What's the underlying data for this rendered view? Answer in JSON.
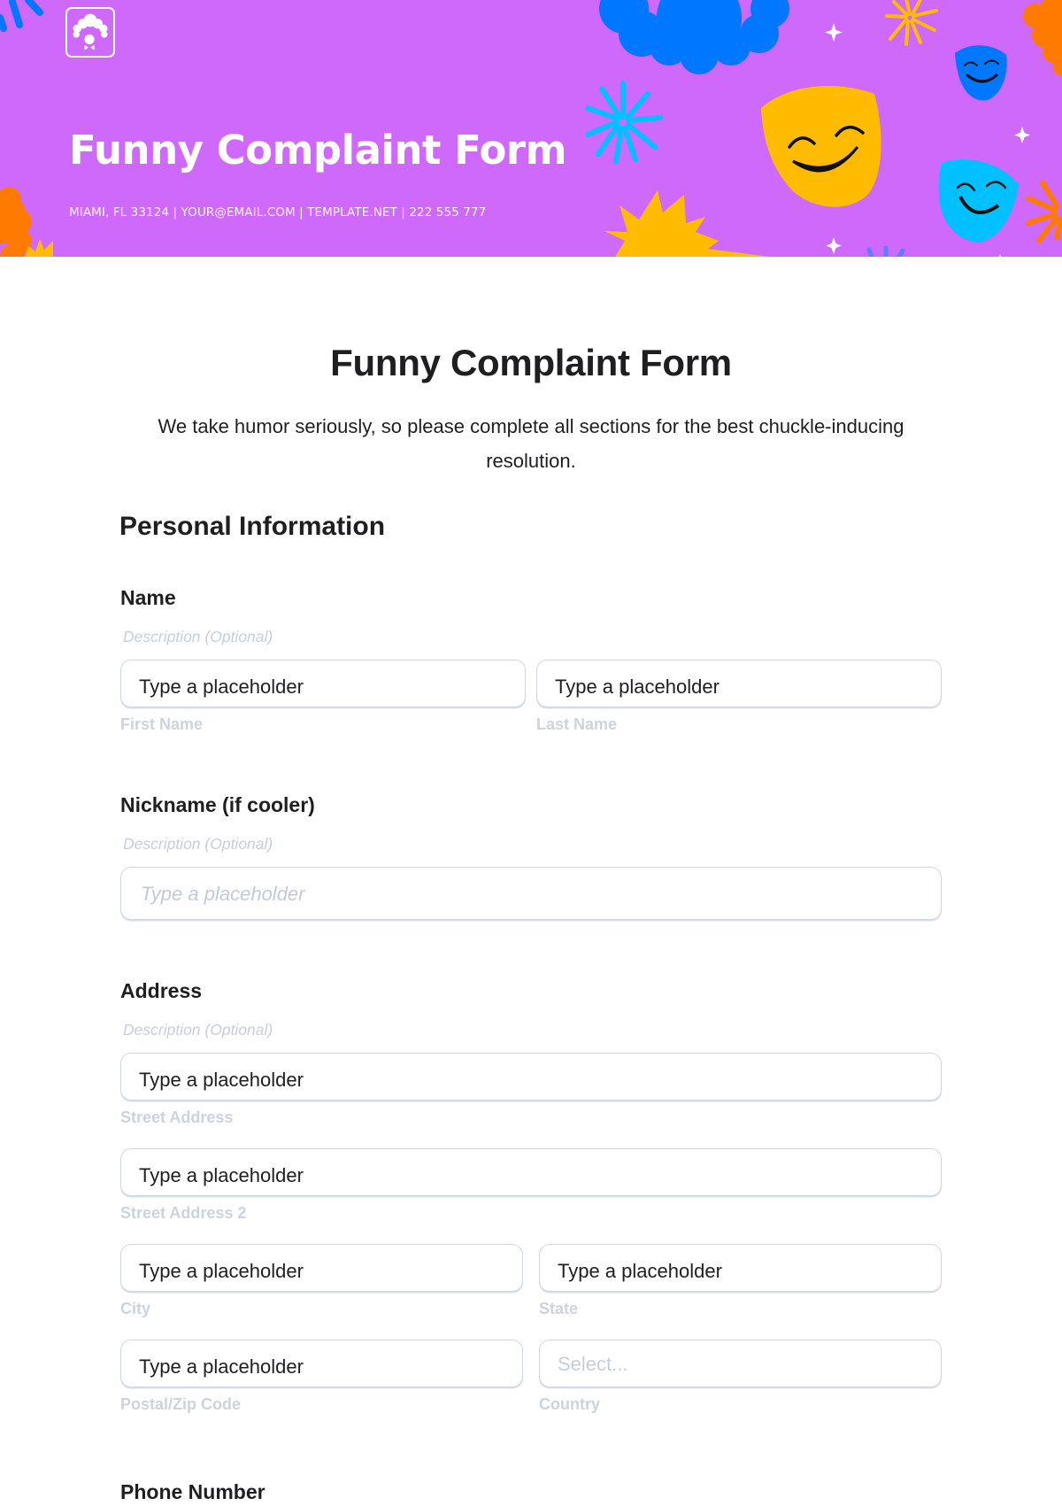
{
  "header": {
    "logo_icon": "clown-face-icon",
    "title": "Funny Complaint Form",
    "contact": "MIAMI, FL 33124 | YOUR@EMAIL.COM | TEMPLATE.NET | 222 555 777",
    "colors": {
      "background": "#cf69fc",
      "yellow": "#ffbb00",
      "blue": "#0077ff",
      "cyan": "#00c0ff",
      "orange": "#ff7a00"
    }
  },
  "form": {
    "title": "Funny Complaint Form",
    "intro": "We take humor seriously, so please complete all sections for the best chuckle-inducing resolution.",
    "section_title": "Personal Information",
    "fields": {
      "name": {
        "label": "Name",
        "description": "Description (Optional)",
        "first": {
          "value": "Type a placeholder",
          "sublabel": "First Name"
        },
        "last": {
          "value": "Type a placeholder",
          "sublabel": "Last Name"
        }
      },
      "nickname": {
        "label": "Nickname (if cooler)",
        "description": "Description (Optional)",
        "placeholder": "Type a placeholder"
      },
      "address": {
        "label": "Address",
        "description": "Description (Optional)",
        "street": {
          "value": "Type a placeholder",
          "sublabel": "Street Address"
        },
        "street2": {
          "value": "Type a placeholder",
          "sublabel": "Street Address 2"
        },
        "city": {
          "value": "Type a placeholder",
          "sublabel": "City"
        },
        "state": {
          "value": "Type a placeholder",
          "sublabel": "State"
        },
        "zip": {
          "value": "Type a placeholder",
          "sublabel": "Postal/Zip Code"
        },
        "country": {
          "placeholder": "Select...",
          "sublabel": "Country"
        }
      },
      "phone": {
        "label": "Phone Number"
      }
    }
  }
}
